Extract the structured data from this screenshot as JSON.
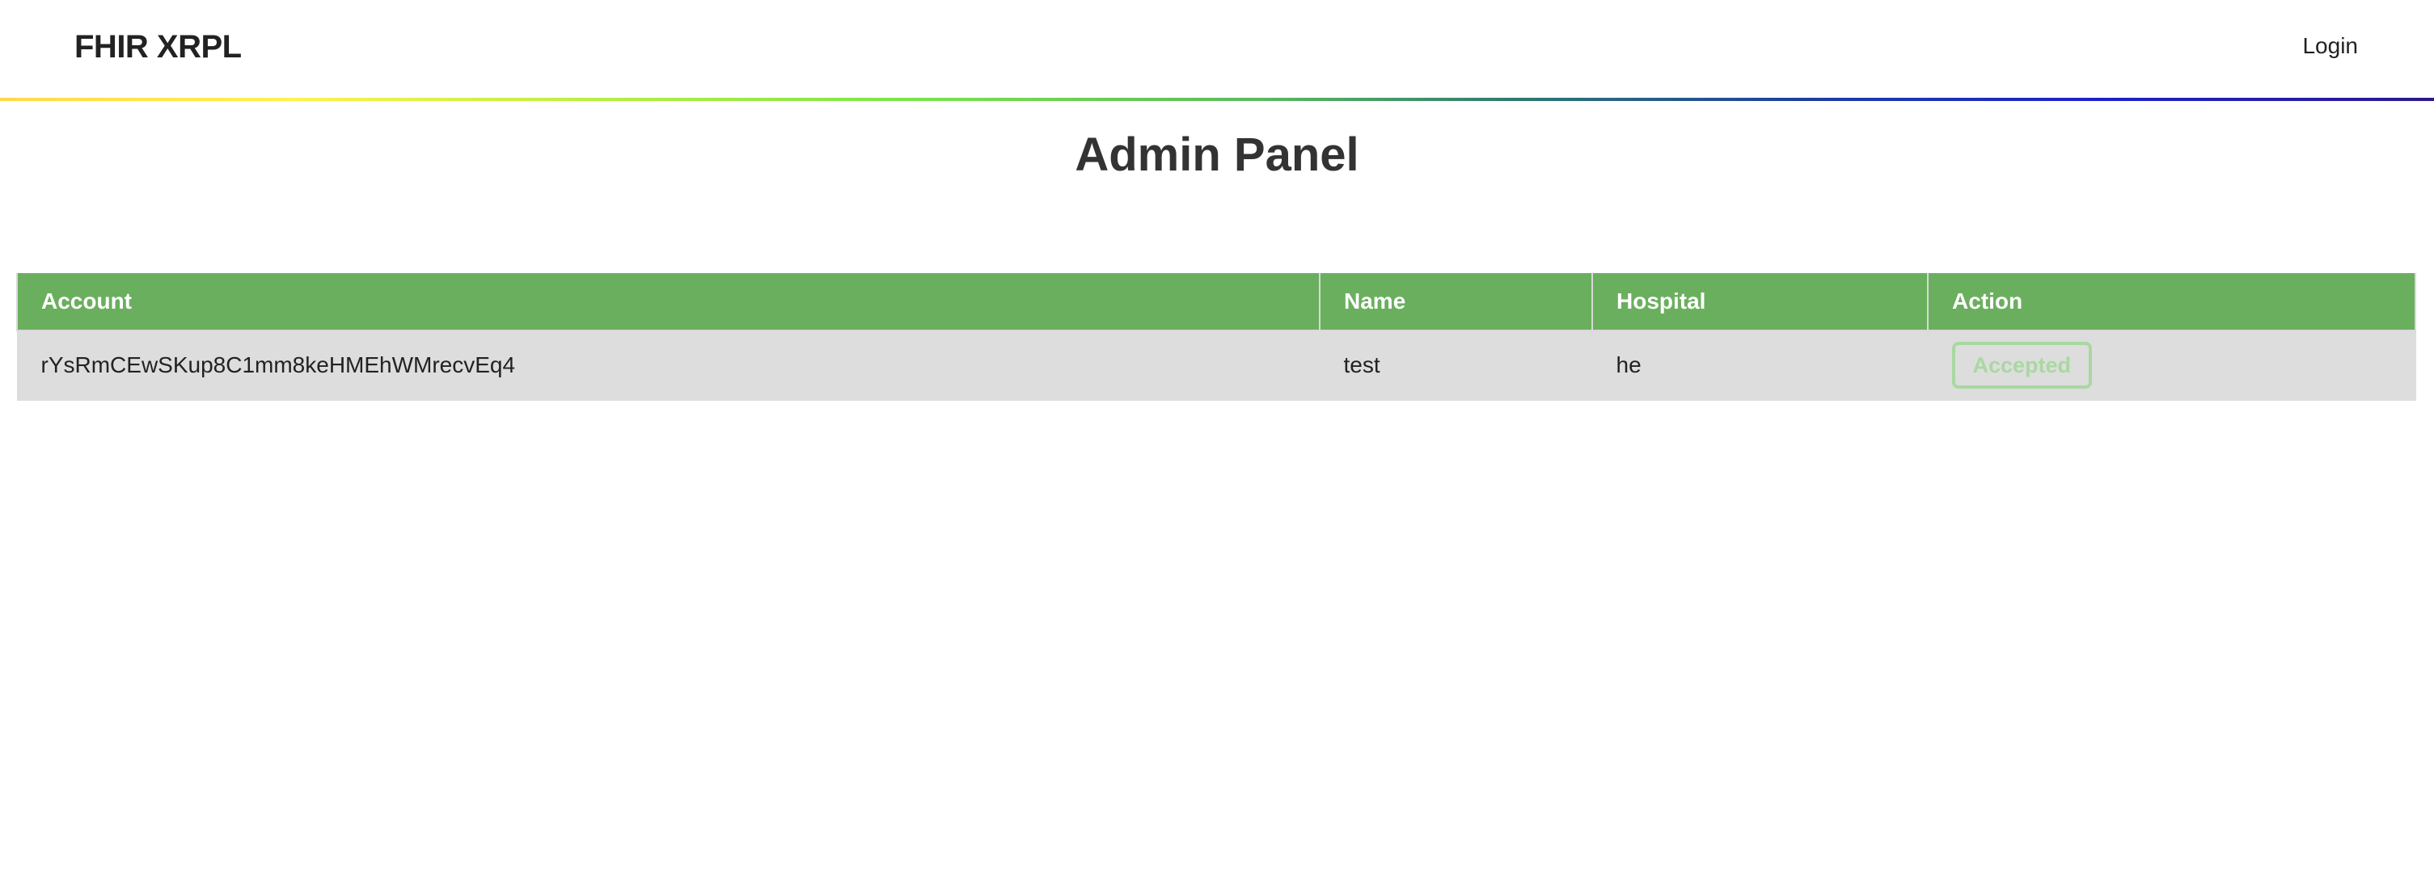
{
  "header": {
    "brand": "FHIR XRPL",
    "login_label": "Login"
  },
  "page": {
    "title": "Admin Panel"
  },
  "table": {
    "columns": [
      "Account",
      "Name",
      "Hospital",
      "Action"
    ],
    "rows": [
      {
        "account": "rYsRmCEwSKup8C1mm8keHMEhWMrecvEq4",
        "name": "test",
        "hospital": "he",
        "action": "Accepted"
      }
    ]
  },
  "colors": {
    "header_green": "#6aaf5e",
    "row_gray": "#dddddd",
    "accepted_green": "#a9d8a1"
  }
}
